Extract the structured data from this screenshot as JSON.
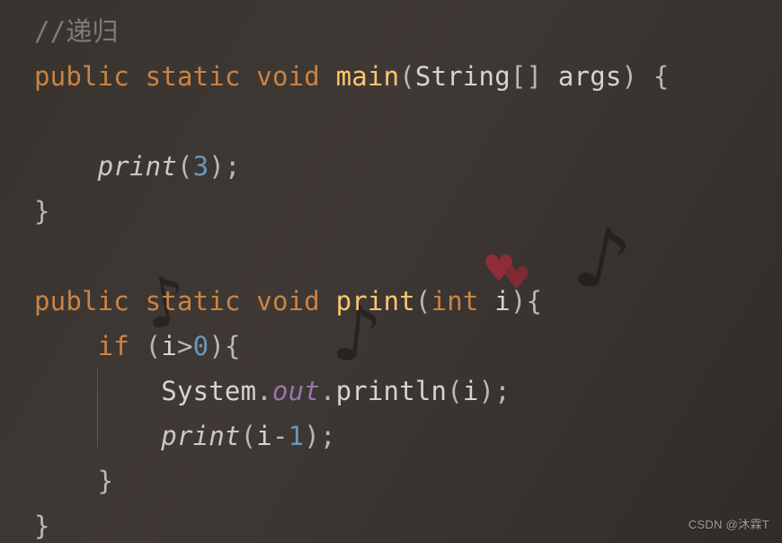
{
  "code": {
    "comment_prefix": "//",
    "comment_text": "递归",
    "kw_public": "public",
    "kw_static": "static",
    "kw_void": "void",
    "kw_int": "int",
    "kw_if": "if",
    "name_main": "main",
    "name_print": "print",
    "type_String": "String",
    "name_System": "System",
    "name_args": "args",
    "name_println": "println",
    "name_out": "out",
    "var_i": "i",
    "lit_3": "3",
    "lit_0": "0",
    "lit_1": "1",
    "brackets": "[]",
    "p_open": "(",
    "p_close": ")",
    "b_open": "{",
    "b_close": "}",
    "semi": ";",
    "dot": ".",
    "gt": ">",
    "minus": "-",
    "space": " "
  },
  "watermark": "CSDN @沐霖T"
}
